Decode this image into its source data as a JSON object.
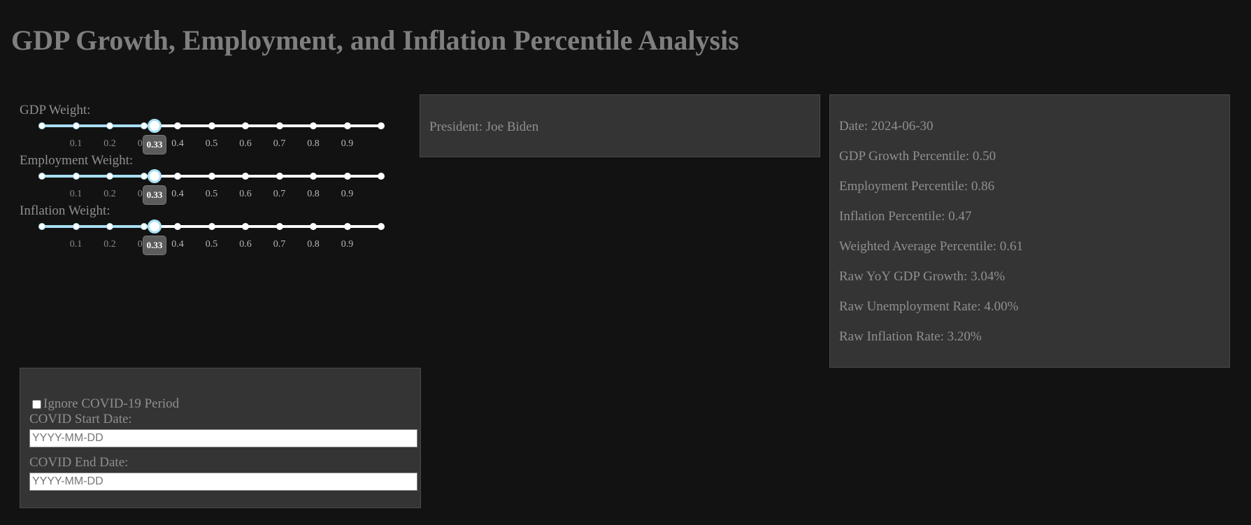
{
  "title": "GDP Growth, Employment, and Inflation Percentile Analysis",
  "sliders": [
    {
      "label": "GDP Weight:",
      "value": 0.33,
      "value_label": "0.33",
      "min": 0,
      "max": 1
    },
    {
      "label": "Employment Weight:",
      "value": 0.33,
      "value_label": "0.33",
      "min": 0,
      "max": 1
    },
    {
      "label": "Inflation Weight:",
      "value": 0.33,
      "value_label": "0.33",
      "min": 0,
      "max": 1
    }
  ],
  "slider_marks": [
    "0.1",
    "0.2",
    "0.3",
    "0.4",
    "0.5",
    "0.6",
    "0.7",
    "0.8",
    "0.9"
  ],
  "president": {
    "text": "President: Joe Biden"
  },
  "stats": [
    "Date: 2024-06-30",
    "GDP Growth Percentile: 0.50",
    "Employment Percentile: 0.86",
    "Inflation Percentile: 0.47",
    "Weighted Average Percentile: 0.61",
    "Raw YoY GDP Growth: 3.04%",
    "Raw Unemployment Rate: 4.00%",
    "Raw Inflation Rate: 3.20%"
  ],
  "covid": {
    "checkbox_label": "Ignore COVID-19 Period",
    "checked": false,
    "start_label": "COVID Start Date:",
    "start_placeholder": "YYYY-MM-DD",
    "start_value": "",
    "end_label": "COVID End Date:",
    "end_placeholder": "YYYY-MM-DD",
    "end_value": ""
  },
  "colors": {
    "background": "#121212",
    "panel": "#343434",
    "accent": "#a8dff3",
    "text": "#8f8f8f"
  }
}
